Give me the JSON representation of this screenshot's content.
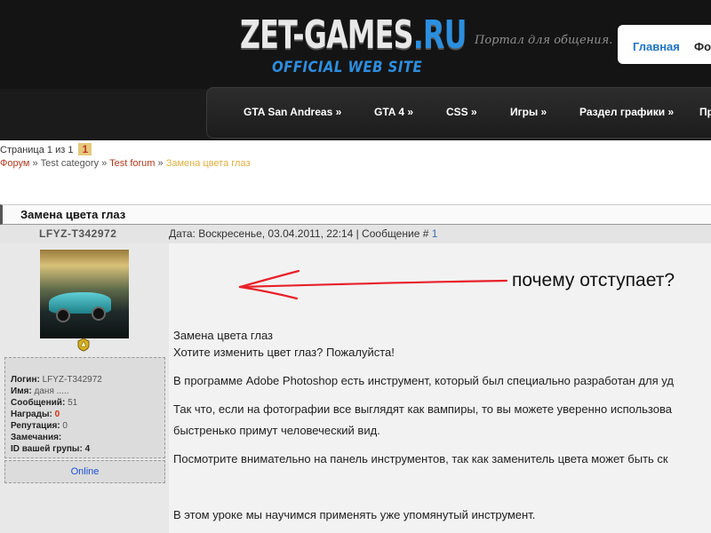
{
  "header": {
    "logo_main": "ZET-GAMES",
    "logo_ru": ".RU",
    "logo_sub": "OFFICIAL WEB SITE",
    "portal_text": "Портал для общения.",
    "top_links": [
      "Главная",
      "Фо"
    ]
  },
  "nav": {
    "items": [
      "GTA San Andreas »",
      "GTA 4 »",
      "CSS »",
      "Игры »",
      "Раздел графики »",
      "Пр"
    ]
  },
  "pagination": {
    "label": "Страница 1 из 1",
    "current": "1"
  },
  "breadcrumb": {
    "items": [
      "Форум",
      "Test category",
      "Test forum",
      "Замена цвета глаз"
    ],
    "separator": " » "
  },
  "topic": {
    "title": "Замена цвета глаз"
  },
  "post": {
    "author": "LFYZ-T342972",
    "date_text": "Дата: Воскресенье, 03.04.2011, 22:14 | Сообщение # ",
    "post_number": "1",
    "user_info": {
      "login_label": "Логин:",
      "login_value": "LFYZ-T342972",
      "name_label": "Имя:",
      "name_value": "даня .....",
      "messages_label": "Сообщений:",
      "messages_value": "51",
      "awards_label": "Награды:",
      "awards_value": "0",
      "reputation_label": "Репутация:",
      "reputation_value": "0",
      "warnings_label": "Замечания:",
      "group_label": "ID вашей групы:",
      "group_value": "4"
    },
    "status": "Online",
    "annotation": "почему отступает?",
    "body": [
      "Замена цвета глаз",
      "Хотите изменить цвет глаз? Пожалуйста!",
      "В программе Adobe Photoshop есть инструмент, который был специально разработан для уд",
      "Так что, если на фотографии все выглядят как вампиры, то вы можете уверенно использова",
      "быстренько примут человеческий вид.",
      "Посмотрите внимательно на панель инструментов, так как заменитель цвета может быть ск",
      "В этом уроке мы научимся применять уже упомянутый инструмент."
    ]
  },
  "colors": {
    "link_blue": "#3b6fae",
    "accent_blue": "#2b8fe0",
    "crumb_link": "#b03a1e",
    "crumb_current": "#e0b040",
    "award_red": "#d03010",
    "annotation_red": "#e8202a"
  },
  "icons": {
    "rank": "rank-badge-icon"
  }
}
